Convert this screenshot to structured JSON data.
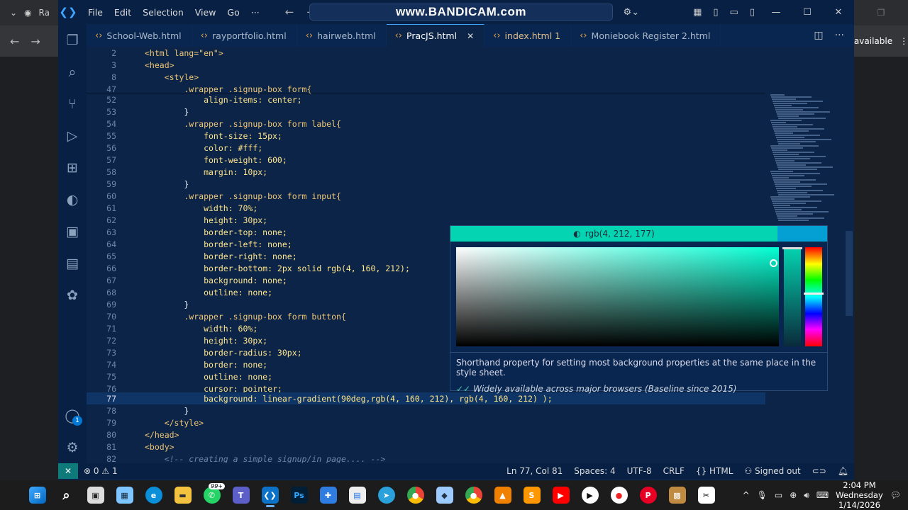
{
  "browser": {
    "tab_text": "Ra",
    "right_text": "available"
  },
  "titlebar": {
    "menu": [
      "File",
      "Edit",
      "Selection",
      "View",
      "Go",
      "···"
    ],
    "watermark": "www.BANDICAM.com"
  },
  "tabs": [
    {
      "label": "School-Web.html",
      "icon": "html-icon"
    },
    {
      "label": "rayportfolio.html",
      "icon": "html-icon"
    },
    {
      "label": "hairweb.html",
      "icon": "html-icon"
    },
    {
      "label": "PracJS.html",
      "icon": "html-icon",
      "active": true
    },
    {
      "label": "index.html 1",
      "icon": "html-icon",
      "modified": true
    },
    {
      "label": "Moniebook Register 2.html",
      "icon": "html-icon"
    }
  ],
  "activity_badge": "1",
  "editor": {
    "lines": [
      {
        "n": "2",
        "code": "<html lang=\"en\">"
      },
      {
        "n": "3",
        "code": "<head>"
      },
      {
        "n": "8",
        "code": "    <style>"
      },
      {
        "n": "47",
        "code": "        .wrapper .signup-box form{"
      },
      {
        "n": "52",
        "code": "            align-items: center;"
      },
      {
        "n": "53",
        "code": "        }"
      },
      {
        "n": "54",
        "code": "        .wrapper .signup-box form label{"
      },
      {
        "n": "55",
        "code": "            font-size: 15px;"
      },
      {
        "n": "56",
        "code": "            color: #fff;"
      },
      {
        "n": "57",
        "code": "            font-weight: 600;"
      },
      {
        "n": "58",
        "code": "            margin: 10px;"
      },
      {
        "n": "59",
        "code": "        }"
      },
      {
        "n": "60",
        "code": "        .wrapper .signup-box form input{"
      },
      {
        "n": "61",
        "code": "            width: 70%;"
      },
      {
        "n": "62",
        "code": "            height: 30px;"
      },
      {
        "n": "63",
        "code": "            border-top: none;"
      },
      {
        "n": "64",
        "code": "            border-left: none;"
      },
      {
        "n": "65",
        "code": "            border-right: none;"
      },
      {
        "n": "66",
        "code": "            border-bottom: 2px solid rgb(4, 160, 212);"
      },
      {
        "n": "67",
        "code": "            background: none;"
      },
      {
        "n": "68",
        "code": "            outline: none;"
      },
      {
        "n": "69",
        "code": "        }"
      },
      {
        "n": "70",
        "code": "        .wrapper .signup-box form button{"
      },
      {
        "n": "71",
        "code": "            width: 60%;"
      },
      {
        "n": "72",
        "code": "            height: 30px;"
      },
      {
        "n": "73",
        "code": "            border-radius: 30px;"
      },
      {
        "n": "74",
        "code": "            border: none;"
      },
      {
        "n": "75",
        "code": "            outline: none;"
      },
      {
        "n": "76",
        "code": "            cursor: pointer;"
      },
      {
        "n": "77",
        "code": "            background: linear-gradient(90deg,rgb(4, 160, 212), rgb(4, 160, 212) );",
        "current": true
      },
      {
        "n": "78",
        "code": "        }"
      },
      {
        "n": "79",
        "code": "    </style>"
      },
      {
        "n": "80",
        "code": "</head>"
      },
      {
        "n": "81",
        "code": "<body>"
      },
      {
        "n": "82",
        "code": "    <!-- creating a simple signup/in page.... -->"
      }
    ],
    "swatch_colors": {
      "white": "#ffffff",
      "blue": "#04a0d4"
    }
  },
  "color_picker": {
    "current_color_label": "rgb(4, 212, 177)",
    "current_color": "#04d4b1",
    "original_color": "#04a0d4",
    "description": "Shorthand property for setting most background properties at the same place in the style sheet.",
    "baseline": "Widely available across major browsers (Baseline since 2015)"
  },
  "statusbar": {
    "errors": "0",
    "warnings": "1",
    "position": "Ln 77, Col 81",
    "spaces": "Spaces: 4",
    "encoding": "UTF-8",
    "eol": "CRLF",
    "language": "HTML",
    "account": "Signed out"
  },
  "taskbar": {
    "whatsapp_badge": "99+",
    "time": "2:04 PM",
    "day": "Wednesday",
    "date": "1/14/2026"
  }
}
